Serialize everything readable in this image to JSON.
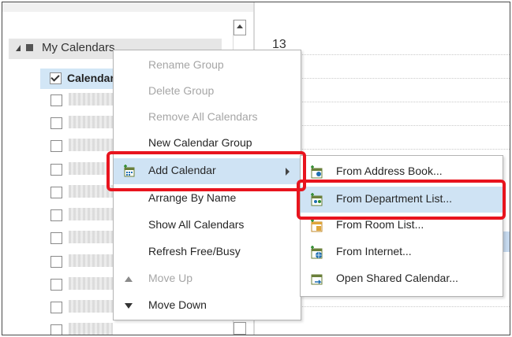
{
  "colors": {
    "highlight_red": "#e8141e",
    "menu_hover": "#cfe3f4",
    "selected_row": "#d2e6f6"
  },
  "folder_pane": {
    "group_label": "My Calendars",
    "selected_calendar": "Calendar"
  },
  "calendar": {
    "hour_label": "13"
  },
  "context_menu": {
    "items": [
      {
        "label": "Rename Group",
        "enabled": false,
        "icon": ""
      },
      {
        "label": "Delete Group",
        "enabled": false,
        "icon": ""
      },
      {
        "label": "Remove All Calendars",
        "enabled": false,
        "icon": ""
      },
      {
        "label": "New Calendar Group",
        "enabled": true,
        "icon": ""
      },
      {
        "label": "Add Calendar",
        "enabled": true,
        "icon": "add-calendar-icon",
        "has_submenu": true
      },
      {
        "label": "Arrange By Name",
        "enabled": true,
        "icon": ""
      },
      {
        "label": "Show All Calendars",
        "enabled": true,
        "icon": ""
      },
      {
        "label": "Refresh Free/Busy",
        "enabled": true,
        "icon": ""
      },
      {
        "label": "Move Up",
        "enabled": false,
        "icon": "up-arrow-icon"
      },
      {
        "label": "Move Down",
        "enabled": true,
        "icon": "down-arrow-icon"
      }
    ]
  },
  "submenu": {
    "items": [
      {
        "label": "From Address Book...",
        "icon": "address-book-icon"
      },
      {
        "label": "From Department List...",
        "icon": "department-list-icon"
      },
      {
        "label": "From Room List...",
        "icon": "room-list-icon"
      },
      {
        "label": "From Internet...",
        "icon": "internet-calendar-icon"
      },
      {
        "label": "Open Shared Calendar...",
        "icon": "shared-calendar-icon"
      }
    ]
  }
}
